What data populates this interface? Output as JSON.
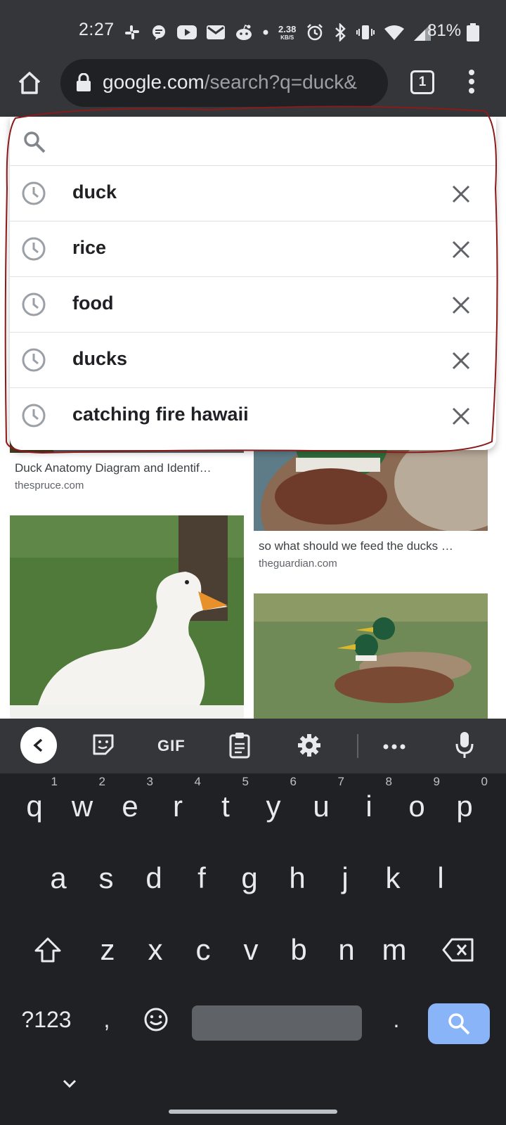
{
  "status_bar": {
    "time": "2:27",
    "net_speed_value": "2.38",
    "net_speed_unit": "KB/S",
    "battery": "81%"
  },
  "browser": {
    "url_host": "google.com",
    "url_path": "/search?q=duck&",
    "tab_count": "1"
  },
  "search": {
    "query": "",
    "suggestions": [
      {
        "label": "duck",
        "icon": "history-clock-icon"
      },
      {
        "label": "rice",
        "icon": "history-clock-icon"
      },
      {
        "label": "food",
        "icon": "history-clock-icon"
      },
      {
        "label": "ducks",
        "icon": "history-clock-icon"
      },
      {
        "label": "catching fire hawaii",
        "icon": "history-clock-icon"
      }
    ]
  },
  "results": [
    {
      "caption": "Duck Anatomy Diagram and Identif…",
      "source": "thespruce.com"
    },
    {
      "caption": "so what should we feed the ducks …",
      "source": "theguardian.com"
    }
  ],
  "keyboard": {
    "gif_label": "GIF",
    "row1": [
      {
        "key": "q",
        "num": "1"
      },
      {
        "key": "w",
        "num": "2"
      },
      {
        "key": "e",
        "num": "3"
      },
      {
        "key": "r",
        "num": "4"
      },
      {
        "key": "t",
        "num": "5"
      },
      {
        "key": "y",
        "num": "6"
      },
      {
        "key": "u",
        "num": "7"
      },
      {
        "key": "i",
        "num": "8"
      },
      {
        "key": "o",
        "num": "9"
      },
      {
        "key": "p",
        "num": "0"
      }
    ],
    "row2": [
      "a",
      "s",
      "d",
      "f",
      "g",
      "h",
      "j",
      "k",
      "l"
    ],
    "row3": [
      "z",
      "x",
      "c",
      "v",
      "b",
      "n",
      "m"
    ],
    "symbols_label": "?123",
    "comma": ",",
    "period": "."
  },
  "colors": {
    "chrome_dark": "#35363a",
    "omnibox": "#202124",
    "keyboard_bg": "#202124",
    "search_key": "#8ab4f8",
    "annotation": "#8b1a1a"
  }
}
